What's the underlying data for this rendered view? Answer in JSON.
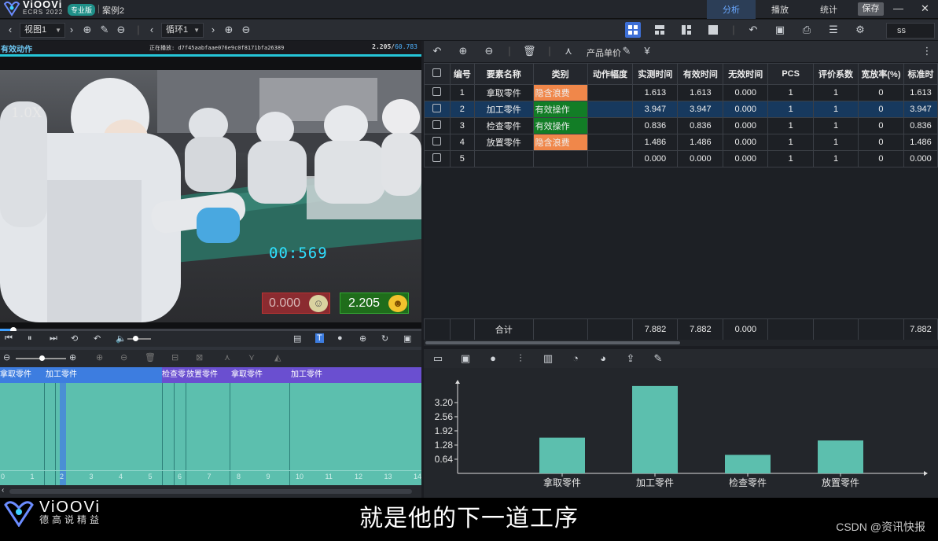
{
  "app": {
    "logo_text": "ViOOVi",
    "logo_sub": "ECRS 2022",
    "edition": "专业版",
    "document": "案例2"
  },
  "nav": [
    {
      "label": "分析",
      "active": true
    },
    {
      "label": "播放",
      "active": false
    },
    {
      "label": "统计",
      "active": false
    }
  ],
  "save_label": "保存",
  "toolbar": {
    "view_select": "视图1",
    "cycle_select": "循环1",
    "search_value": "ss"
  },
  "video": {
    "label": "有效动作",
    "playing": "正在播放: d7f45aabfaae076e9c0f8171bfa26389",
    "frame_current": "2.205",
    "frame_total": "60.783",
    "speed": "1.0X",
    "timer": "00:569",
    "invalid_value": "0.000",
    "valid_value": "2.205",
    "progress": 0.03
  },
  "timeline": {
    "segments": [
      {
        "label": "拿取零件",
        "color": "#3d7de0"
      },
      {
        "label": "加工零件",
        "color": "#3d7de0"
      },
      {
        "label": "检查零件",
        "color": "#6a4fd0"
      },
      {
        "label": "放置零件",
        "color": "#6a4fd0"
      },
      {
        "label": "拿取零件",
        "color": "#6a4fd0"
      },
      {
        "label": "加工零件",
        "color": "#6a4fd0"
      }
    ],
    "ticks": [
      "0",
      "1",
      "2",
      "3",
      "4",
      "5",
      "6",
      "7",
      "8",
      "9",
      "10",
      "11",
      "12",
      "13",
      "14"
    ]
  },
  "table": {
    "product_price_label": "产品单价",
    "headers": [
      "编号",
      "要素名称",
      "类别",
      "动作幅度",
      "实测时间",
      "有效时间",
      "无效时间",
      "PCS",
      "评价系数",
      "宽放率(%)",
      "标准时"
    ],
    "rows": [
      {
        "no": "1",
        "name": "拿取零件",
        "cat": "隐含浪费",
        "cat_type": "waste",
        "amp": "",
        "measured": "1.613",
        "valid": "1.613",
        "invalid": "0.000",
        "pcs": "1",
        "eval": "1",
        "allow": "0",
        "std": "1.613",
        "selected": false
      },
      {
        "no": "2",
        "name": "加工零件",
        "cat": "有效操作",
        "cat_type": "valid",
        "amp": "",
        "measured": "3.947",
        "valid": "3.947",
        "invalid": "0.000",
        "pcs": "1",
        "eval": "1",
        "allow": "0",
        "std": "3.947",
        "selected": true
      },
      {
        "no": "3",
        "name": "检查零件",
        "cat": "有效操作",
        "cat_type": "valid",
        "amp": "",
        "measured": "0.836",
        "valid": "0.836",
        "invalid": "0.000",
        "pcs": "1",
        "eval": "1",
        "allow": "0",
        "std": "0.836",
        "selected": false
      },
      {
        "no": "4",
        "name": "放置零件",
        "cat": "隐含浪费",
        "cat_type": "waste",
        "amp": "",
        "measured": "1.486",
        "valid": "1.486",
        "invalid": "0.000",
        "pcs": "1",
        "eval": "1",
        "allow": "0",
        "std": "1.486",
        "selected": false
      },
      {
        "no": "5",
        "name": "",
        "cat": "",
        "cat_type": "",
        "amp": "",
        "measured": "0.000",
        "valid": "0.000",
        "invalid": "0.000",
        "pcs": "1",
        "eval": "1",
        "allow": "0",
        "std": "0.000",
        "selected": false
      }
    ],
    "total": {
      "label": "合计",
      "measured": "7.882",
      "valid": "7.882",
      "invalid": "0.000",
      "std": "7.882"
    }
  },
  "chart_data": {
    "type": "bar",
    "categories": [
      "拿取零件",
      "加工零件",
      "检查零件",
      "放置零件"
    ],
    "values": [
      1.613,
      3.947,
      0.836,
      1.486
    ],
    "yticks": [
      "3.20",
      "2.56",
      "1.92",
      "1.28",
      "0.64"
    ],
    "ylim": [
      0,
      4.05
    ],
    "bar_color": "#5cbfae",
    "grid": false
  },
  "subtitle": "就是他的下一道工序",
  "watermark": "CSDN @资讯快报",
  "footer_logo": {
    "text": "ViOOVi",
    "sub": "德高说精益"
  }
}
